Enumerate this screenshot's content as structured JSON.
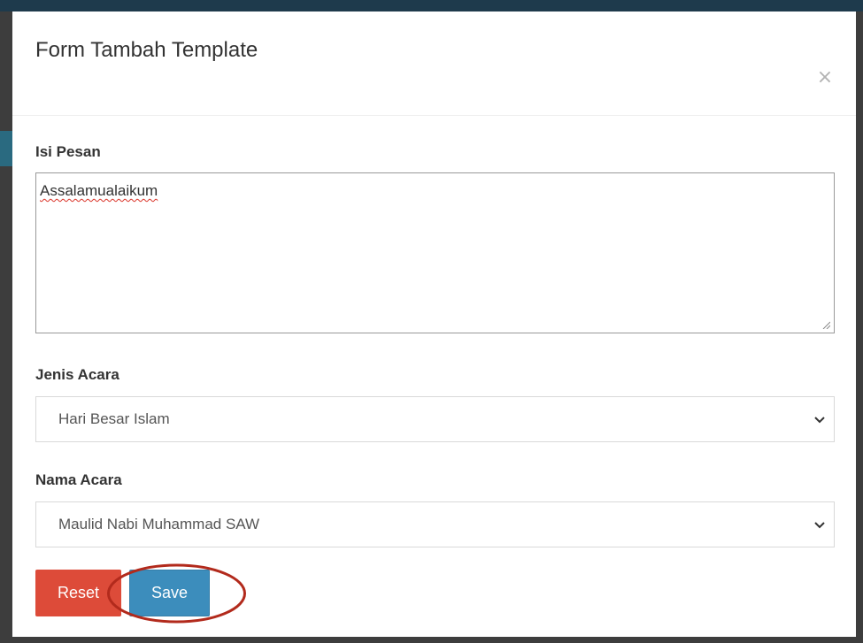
{
  "modal": {
    "title": "Form Tambah Template",
    "close_symbol": "×"
  },
  "form": {
    "isi_pesan": {
      "label": "Isi Pesan",
      "value": "Assalamualaikum"
    },
    "jenis_acara": {
      "label": "Jenis Acara",
      "selected": "Hari Besar Islam"
    },
    "nama_acara": {
      "label": "Nama Acara",
      "selected": "Maulid Nabi Muhammad SAW"
    }
  },
  "buttons": {
    "reset_label": "Reset",
    "save_label": "Save"
  },
  "colors": {
    "reset": "#dd4b39",
    "save": "#3c8dbc",
    "highlight": "#b22a1c"
  },
  "icons": {
    "close": "close-icon",
    "dropdown": "chevron-down-icon",
    "resize": "resize-grip-icon"
  }
}
